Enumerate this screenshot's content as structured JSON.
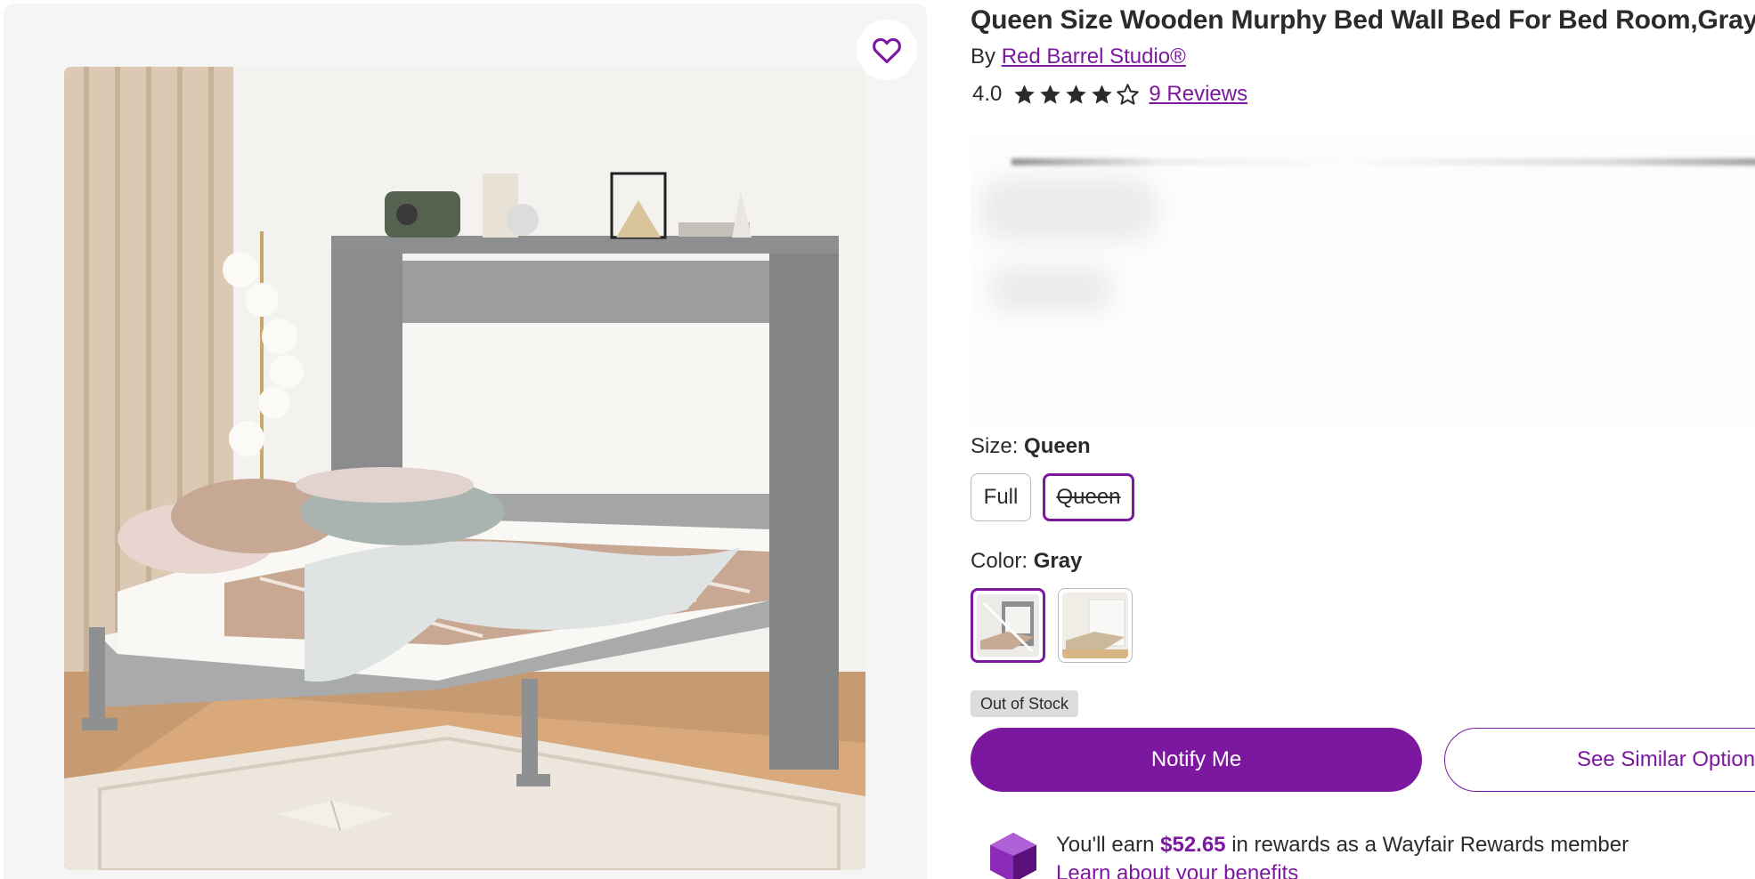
{
  "product": {
    "title": "Queen Size Wooden Murphy Bed Wall Bed For Bed Room,Gray",
    "by_prefix": "By",
    "brand": "Red Barrel Studio®",
    "rating_value": "4.0",
    "rating_stars": 4,
    "reviews_label": "9 Reviews"
  },
  "options": {
    "size_label": "Size:",
    "size_value": "Queen",
    "sizes": [
      "Full",
      "Queen"
    ],
    "color_label": "Color:",
    "color_value": "Gray"
  },
  "status": {
    "stock": "Out of Stock"
  },
  "actions": {
    "notify": "Notify Me",
    "similar": "See Similar Option"
  },
  "rewards": {
    "earn_prefix": "You'll earn",
    "amount": "$52.65",
    "earn_suffix": "in rewards as a Wayfair Rewards member",
    "link": "Learn about your benefits"
  },
  "colors": {
    "accent": "#7b189f",
    "panel_bg": "#f5f5f5",
    "badge_bg": "#dcdcdc"
  },
  "icons": {
    "favorite": "heart-outline-icon",
    "star": "star-icon",
    "rewards": "rewards-gem-icon"
  }
}
